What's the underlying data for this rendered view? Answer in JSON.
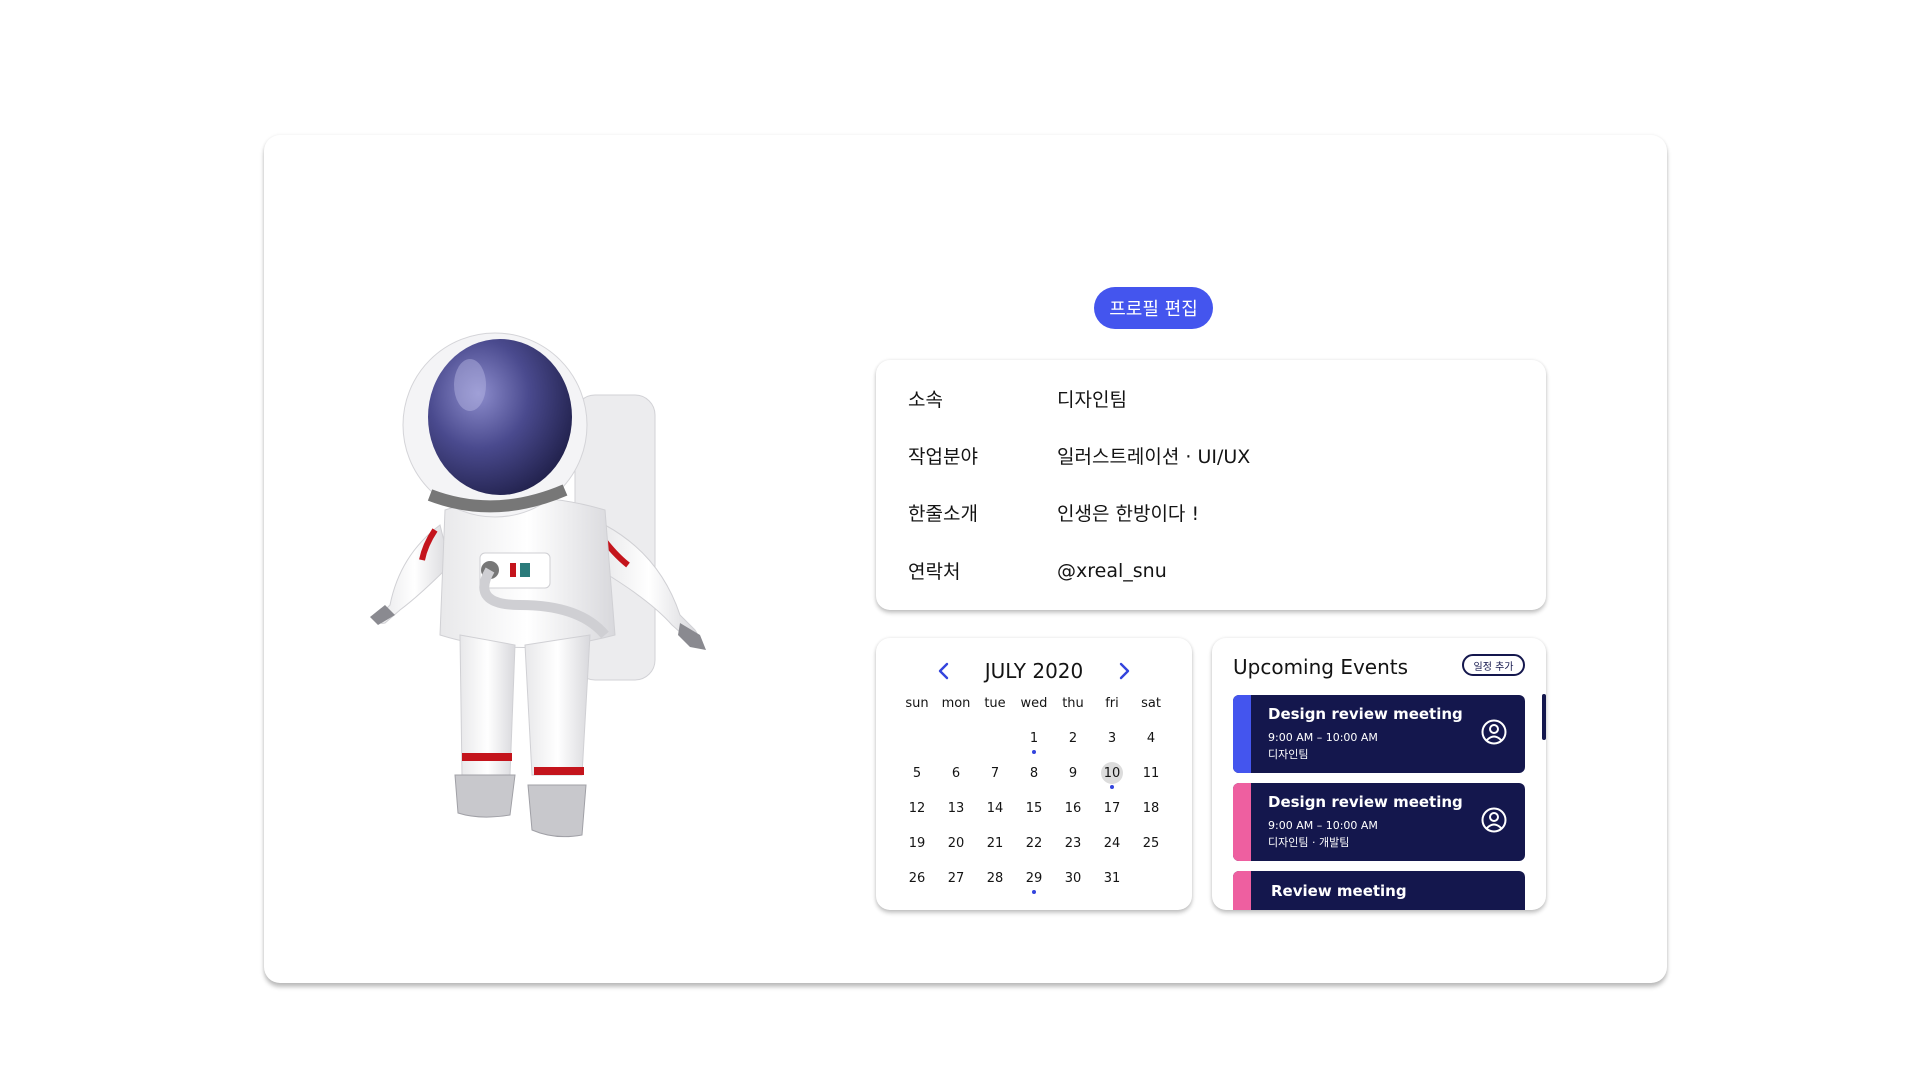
{
  "profile": {
    "edit_button": "프로필 편집",
    "rows": [
      {
        "label": "소속",
        "value": "디자인팀"
      },
      {
        "label": "작업분야",
        "value": "일러스트레이션 · UI/UX"
      },
      {
        "label": "한줄소개",
        "value": "인생은 한방이다 !"
      },
      {
        "label": "연락처",
        "value": "@xreal_snu"
      }
    ]
  },
  "calendar": {
    "title": "JULY 2020",
    "weekdays": [
      "sun",
      "mon",
      "tue",
      "wed",
      "thu",
      "fri",
      "sat"
    ],
    "first_weekday_index": 3,
    "days_in_month": 31,
    "today": 10,
    "event_days": [
      1,
      10,
      29
    ],
    "accent_color": "#3344dd"
  },
  "events": {
    "title": "Upcoming Events",
    "add_button": "일정 추가",
    "items": [
      {
        "name": "Design review meeting",
        "time": "9:00 AM – 10:00 AM",
        "team": "디자인팀",
        "color": "#4455ee"
      },
      {
        "name": "Design review meeting",
        "time": "9:00 AM – 10:00 AM",
        "team": "디자인팀 · 개발팀",
        "color": "#ee5fa0"
      },
      {
        "name": "Review meeting",
        "time": "",
        "team": "",
        "color": "#ee5fa0"
      }
    ]
  },
  "colors": {
    "primary": "#4455ee",
    "navy": "#14174d",
    "pink": "#ee5fa0"
  },
  "icons": {
    "prev": "chevron-left-icon",
    "next": "chevron-right-icon",
    "user": "user-circle-icon"
  }
}
